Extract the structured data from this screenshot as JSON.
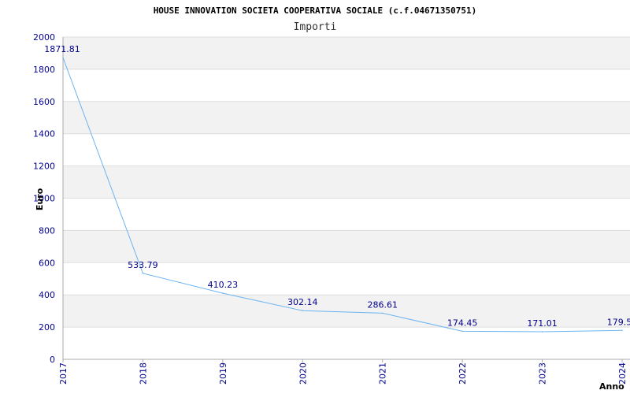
{
  "chart_data": {
    "type": "line",
    "title": "HOUSE INNOVATION SOCIETA COOPERATIVA SOCIALE (c.f.04671350751)",
    "subtitle": "Importi",
    "xlabel": "Anno",
    "ylabel": "Euro",
    "x": [
      "2017",
      "2018",
      "2019",
      "2020",
      "2021",
      "2022",
      "2023",
      "2024"
    ],
    "values": [
      1871.81,
      533.79,
      410.23,
      302.14,
      286.61,
      174.45,
      171.01,
      179.5
    ],
    "value_labels": [
      "1871.81",
      "533.79",
      "410.23",
      "302.14",
      "286.61",
      "174.45",
      "171.01",
      "179.50"
    ],
    "ylim": [
      0,
      2000
    ],
    "yticks": [
      0,
      200,
      400,
      600,
      800,
      1000,
      1200,
      1400,
      1600,
      1800,
      2000
    ],
    "grid": true,
    "legend": "none",
    "colors": {
      "line": "#6cb4f0",
      "tick_text": "#00008b",
      "band": "#f2f2f2",
      "grid": "#dddddd",
      "axis": "#aaaaaa"
    }
  }
}
